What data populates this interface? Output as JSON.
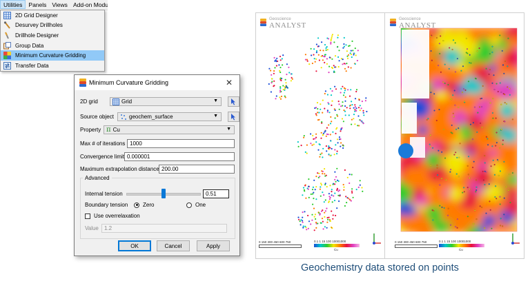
{
  "menubar": {
    "items": [
      "Utilities",
      "Panels",
      "Views",
      "Add-on Modu"
    ]
  },
  "utilities_menu": {
    "items": [
      {
        "label": "2D Grid Designer",
        "icon": "grid-icon"
      },
      {
        "label": "Desurvey Drillholes",
        "icon": "drillhole-icon"
      },
      {
        "label": "Drillhole Designer",
        "icon": "drillhole-design-icon"
      },
      {
        "label": "Group Data",
        "icon": "group-data-icon"
      },
      {
        "label": "Minimum Curvature Gridding",
        "icon": "min-curvature-icon"
      },
      {
        "label": "Transfer Data",
        "icon": "transfer-data-icon"
      }
    ]
  },
  "dialog": {
    "title": "Minimum Curvature Gridding",
    "close_glyph": "✕",
    "grid_label": "2D grid",
    "grid_value": "Grid",
    "source_label": "Source object",
    "source_value": "geochem_surface",
    "property_label": "Property",
    "property_value": "Cu",
    "property_glyph": "π",
    "max_iter_label": "Max # of iterations",
    "max_iter_value": "1000",
    "conv_label": "Convergence limit",
    "conv_value": "0.000001",
    "max_extrap_label": "Maximum extrapolation distance",
    "max_extrap_value": "200.00",
    "advanced_label": "Advanced",
    "internal_tension_label": "Internal tension",
    "internal_tension_value": "0.51",
    "boundary_label": "Boundary tension",
    "boundary_zero": "Zero",
    "boundary_one": "One",
    "boundary_selected": "Zero",
    "overrelax_label": "Use overrelaxation",
    "value_label": "Value",
    "value_value": "1.2",
    "ok": "OK",
    "cancel": "Cancel",
    "apply": "Apply"
  },
  "maps": {
    "logo_small": "Geoscience",
    "logo_big": "ANALYST",
    "scale_text": "0  150 300 450 600 750",
    "colorbar_ticks": "0.1    1    15   100 10001000",
    "colorbar_label": "Cu",
    "colors": {
      "low": "#1a4dd8",
      "mid_low": "#00c8c8",
      "mid": "#2ecc2e",
      "mid_high": "#f2e600",
      "high": "#ff7a00",
      "top": "#e8123c",
      "max": "#e040c0"
    }
  },
  "caption": "Geochemistry data stored on points"
}
